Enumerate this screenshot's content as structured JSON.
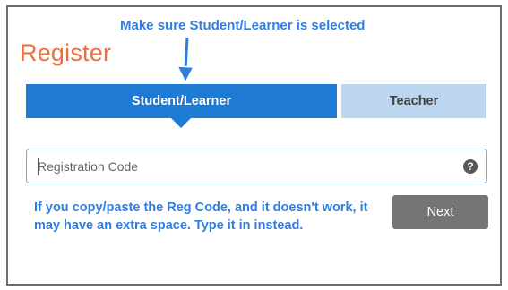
{
  "form": {
    "title": "Register",
    "tabs": [
      {
        "label": "Student/Learner",
        "selected": true
      },
      {
        "label": "Teacher",
        "selected": false
      }
    ],
    "registration_code": {
      "placeholder": "Registration Code",
      "value": ""
    },
    "help_icon": {
      "glyph": "?",
      "icon": "question-circle-icon"
    },
    "next_label": "Next"
  },
  "annotations": {
    "top_callout": "Make sure Student/Learner is selected",
    "bottom_callout": "If you copy/paste the Reg Code, and it doesn't work, it may have an extra space. Type it in instead."
  },
  "colors": {
    "title": "#ee6d3e",
    "tab_selected": "#1e7ad2",
    "tab_unselected": "#bcd6ef",
    "button": "#757575",
    "callout_text": "#2f7fe0"
  }
}
